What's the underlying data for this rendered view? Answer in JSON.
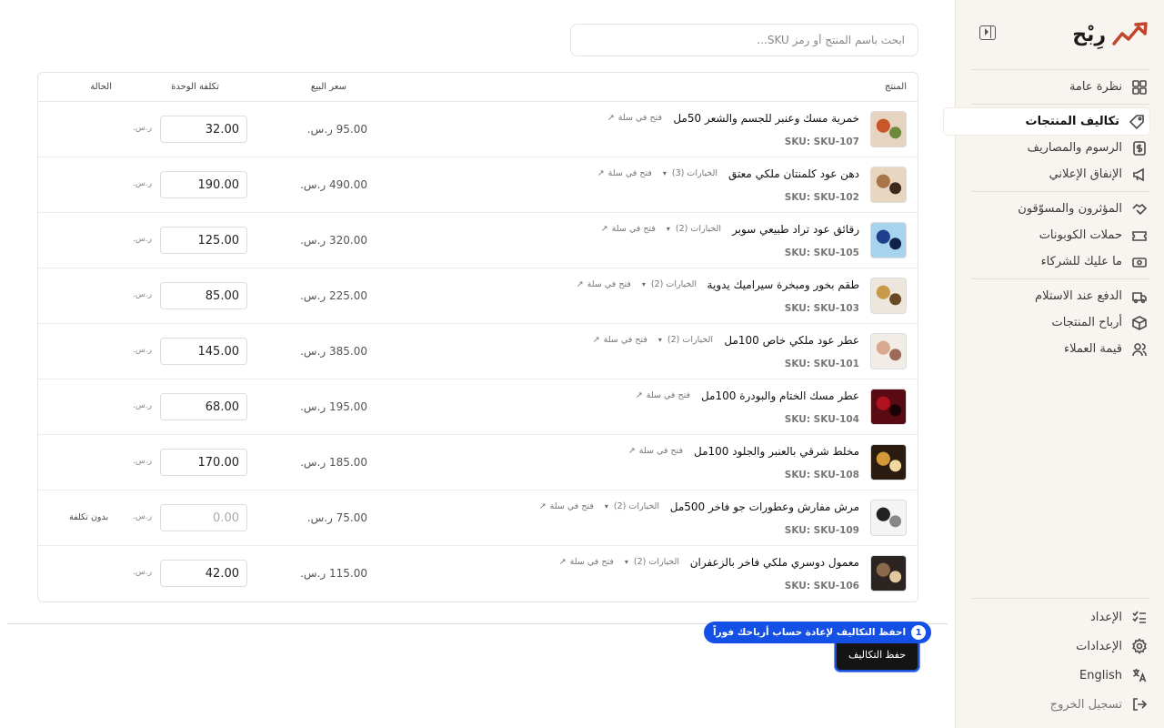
{
  "brand": {
    "name": "رِبْح",
    "accent": "#c2452d"
  },
  "sidebar": {
    "groups": [
      [
        {
          "label": "نظرة عامة",
          "icon": "grid-icon"
        }
      ],
      [
        {
          "label": "تكاليف المنتجات",
          "icon": "tag-icon",
          "active": true
        },
        {
          "label": "الرسوم والمصاريف",
          "icon": "dollar-icon"
        },
        {
          "label": "الإنفاق الإعلاني",
          "icon": "megaphone-icon"
        }
      ],
      [
        {
          "label": "المؤثرون والمسوّقون",
          "icon": "handshake-icon"
        },
        {
          "label": "حملات الكوبونات",
          "icon": "ticket-icon"
        },
        {
          "label": "ما عليك للشركاء",
          "icon": "banknote-icon"
        }
      ],
      [
        {
          "label": "الدفع عند الاستلام",
          "icon": "truck-icon"
        },
        {
          "label": "أرباح المنتجات",
          "icon": "box-icon"
        },
        {
          "label": "قيمة العملاء",
          "icon": "users-icon"
        }
      ]
    ],
    "bottom": [
      {
        "label": "الإعداد",
        "icon": "checklist-icon"
      },
      {
        "label": "الإعدادات",
        "icon": "gear-icon"
      },
      {
        "label": "English",
        "icon": "translate-icon"
      },
      {
        "label": "تسجيل الخروج",
        "icon": "logout-icon"
      }
    ]
  },
  "search": {
    "placeholder": "ابحث باسم المنتج أو رمز SKU..."
  },
  "table": {
    "headers": {
      "product": "المنتج",
      "price": "سعر البيع",
      "cost": "تكلفة الوحدة",
      "status": "الحالة"
    },
    "currency": "ر.س.",
    "open_cart": "فتح في سلة",
    "rows": [
      {
        "name": "خمرية مسك وعنبر للجسم والشعر 50مل",
        "sku": "SKU: SKU-107",
        "options": "",
        "price": "95.00 ر.س.",
        "cost": "32.00",
        "status": "",
        "thumb": [
          "#e6d3c0",
          "#c9562a",
          "#6d8a3b"
        ]
      },
      {
        "name": "دهن عود كلمنتان ملكي معتق",
        "sku": "SKU: SKU-102",
        "options": "الخيارات (3)",
        "price": "490.00 ر.س.",
        "cost": "190.00",
        "status": "",
        "thumb": [
          "#e8d6c0",
          "#a8744a",
          "#3e2a1c"
        ]
      },
      {
        "name": "رقائق عود تراد طبيعي سوبر",
        "sku": "SKU: SKU-105",
        "options": "الخيارات (2)",
        "price": "320.00 ر.س.",
        "cost": "125.00",
        "status": "",
        "thumb": [
          "#a7d3ef",
          "#1f3f8a",
          "#10224a"
        ]
      },
      {
        "name": "طقم بخور ومبخرة سيراميك يدوية",
        "sku": "SKU: SKU-103",
        "options": "الخيارات (2)",
        "price": "225.00 ر.س.",
        "cost": "85.00",
        "status": "",
        "thumb": [
          "#ece6dc",
          "#c79a4a",
          "#6a4a22"
        ]
      },
      {
        "name": "عطر عود ملكي خاص 100مل",
        "sku": "SKU: SKU-101",
        "options": "الخيارات (2)",
        "price": "385.00 ر.س.",
        "cost": "145.00",
        "status": "",
        "thumb": [
          "#f1ece6",
          "#d9a98f",
          "#9c6a57"
        ]
      },
      {
        "name": "عطر مسك الختام والبودرة 100مل",
        "sku": "SKU: SKU-104",
        "options": "",
        "price": "195.00 ر.س.",
        "cost": "68.00",
        "status": "",
        "thumb": [
          "#5a0a12",
          "#b0131f",
          "#1a0305"
        ]
      },
      {
        "name": "مخلط شرقي بالعنبر والجلود 100مل",
        "sku": "SKU: SKU-108",
        "options": "",
        "price": "185.00 ر.س.",
        "cost": "170.00",
        "status": "",
        "thumb": [
          "#2a1c10",
          "#d49a3a",
          "#f0d8a0"
        ]
      },
      {
        "name": "مرش مفارش وعطورات جو فاخر 500مل",
        "sku": "SKU: SKU-109",
        "options": "الخيارات (2)",
        "price": "75.00 ر.س.",
        "cost": "0.00",
        "empty": true,
        "status": "بدون تكلفة",
        "thumb": [
          "#f4f4f4",
          "#222222",
          "#888888"
        ]
      },
      {
        "name": "معمول دوسري ملكي فاخر بالزعفران",
        "sku": "SKU: SKU-106",
        "options": "الخيارات (2)",
        "price": "115.00 ر.س.",
        "cost": "42.00",
        "status": "",
        "thumb": [
          "#2b2420",
          "#8a6a4a",
          "#e3c9a0"
        ]
      }
    ]
  },
  "footer": {
    "save_label": "حفظ التكاليف",
    "tip_number": "1",
    "tip_text": "احفظ التكاليف لإعادة حساب أرباحك فوراً",
    "tip_color": "#1450e6"
  }
}
